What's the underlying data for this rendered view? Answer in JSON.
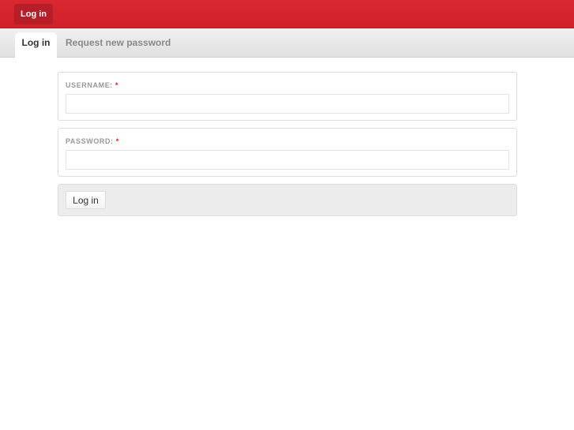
{
  "header": {
    "login_link": "Log in"
  },
  "tabs": [
    {
      "label": "Log in",
      "active": true
    },
    {
      "label": "Request new password",
      "active": false
    }
  ],
  "form": {
    "username": {
      "label": "USERNAME:",
      "required": "*",
      "value": ""
    },
    "password": {
      "label": "PASSWORD:",
      "required": "*",
      "value": ""
    },
    "submit_label": "Log in"
  },
  "colors": {
    "brand": "#d5232c"
  }
}
